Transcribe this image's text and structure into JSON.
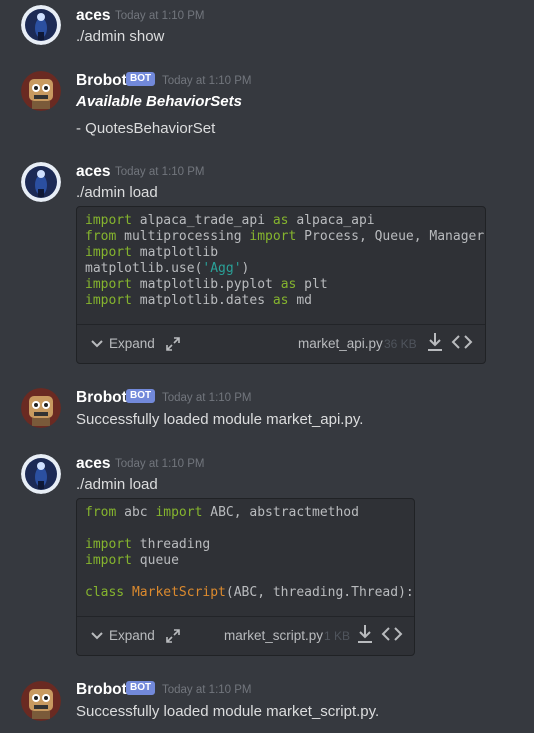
{
  "messages": [
    {
      "username": "aces",
      "timestamp": "Today at 1:10 PM",
      "text": "./admin show"
    },
    {
      "username": "Brobot",
      "badge": "BOT",
      "timestamp": "Today at 1:10 PM",
      "title": "Available BehaviorSets",
      "text": "- QuotesBehaviorSet"
    },
    {
      "username": "aces",
      "timestamp": "Today at 1:10 PM",
      "text": "./admin load",
      "attachment": {
        "expand_label": "Expand",
        "filename": "market_api.py",
        "filesize": "36 KB"
      }
    },
    {
      "username": "Brobot",
      "badge": "BOT",
      "timestamp": "Today at 1:10 PM",
      "text": "Successfully loaded module market_api.py."
    },
    {
      "username": "aces",
      "timestamp": "Today at 1:10 PM",
      "text": "./admin load",
      "attachment": {
        "expand_label": "Expand",
        "filename": "market_script.py",
        "filesize": "1 KB"
      }
    },
    {
      "username": "Brobot",
      "badge": "BOT",
      "timestamp": "Today at 1:10 PM",
      "text": "Successfully loaded module market_script.py."
    }
  ],
  "code1": [
    [
      [
        "kw",
        "import"
      ],
      [
        "t",
        " alpaca_trade_api "
      ],
      [
        "kw",
        "as"
      ],
      [
        "t",
        " alpaca_api"
      ]
    ],
    [
      [
        "kw",
        "from"
      ],
      [
        "t",
        " multiprocessing "
      ],
      [
        "kw",
        "import"
      ],
      [
        "t",
        " Process, Queue, Manager"
      ]
    ],
    [
      [
        "kw",
        "import"
      ],
      [
        "t",
        " matplotlib"
      ]
    ],
    [
      [
        "t",
        "matplotlib.use("
      ],
      [
        "str",
        "'Agg'"
      ],
      [
        "t",
        ")"
      ]
    ],
    [
      [
        "kw",
        "import"
      ],
      [
        "t",
        " matplotlib.pyplot "
      ],
      [
        "kw",
        "as"
      ],
      [
        "t",
        " plt"
      ]
    ],
    [
      [
        "kw",
        "import"
      ],
      [
        "t",
        " matplotlib.dates "
      ],
      [
        "kw",
        "as"
      ],
      [
        "t",
        " md"
      ]
    ]
  ],
  "code2": [
    [
      [
        "kw",
        "from"
      ],
      [
        "t",
        " abc "
      ],
      [
        "kw",
        "import"
      ],
      [
        "t",
        " ABC, abstractmethod"
      ]
    ],
    [
      [
        "t",
        ""
      ]
    ],
    [
      [
        "kw",
        "import"
      ],
      [
        "t",
        " threading"
      ]
    ],
    [
      [
        "kw",
        "import"
      ],
      [
        "t",
        " queue"
      ]
    ],
    [
      [
        "t",
        ""
      ]
    ],
    [
      [
        "kw",
        "class"
      ],
      [
        "t",
        " "
      ],
      [
        "cls",
        "MarketScript"
      ],
      [
        "t",
        "(ABC, threading.Thread):"
      ]
    ]
  ],
  "colors": {
    "background": "#36393f",
    "bot_badge": "#7289da",
    "keyword": "#85b42e",
    "string": "#2aa198",
    "class_name": "#dc8a2e"
  }
}
